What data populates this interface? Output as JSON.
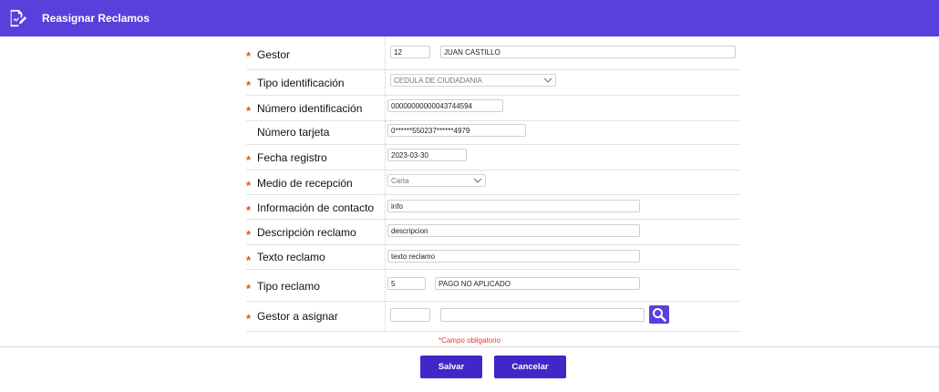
{
  "header": {
    "title": "Reasignar Reclamos",
    "icon": "edit-document-icon"
  },
  "form": {
    "gestor": {
      "label": "Gestor",
      "code": "12",
      "name": "JUAN CASTILLO"
    },
    "tipo_identificacion": {
      "label": "Tipo identificación",
      "selected": "CEDULA DE CIUDADANIA"
    },
    "numero_identificacion": {
      "label": "Número identificación",
      "value": "00000000000043744594"
    },
    "numero_tarjeta": {
      "label": "Número tarjeta",
      "value": "0******550237******4979"
    },
    "fecha_registro": {
      "label": "Fecha registro",
      "value": "2023-03-30"
    },
    "medio_recepcion": {
      "label": "Medio de recepción",
      "selected": "Carta"
    },
    "informacion_contacto": {
      "label": "Información de contacto",
      "value": "info"
    },
    "descripcion_reclamo": {
      "label": "Descripción reclamo",
      "value": "descripcion"
    },
    "texto_reclamo": {
      "label": "Texto reclamo",
      "value": "texto reclamo"
    },
    "tipo_reclamo": {
      "label": "Tipo reclamo",
      "code": "5",
      "name": "PAGO NO APLICADO"
    },
    "gestor_asignar": {
      "label": "Gestor a asignar",
      "code": "",
      "name": ""
    },
    "required_mark": "*",
    "required_note": "*Campo obligatorio"
  },
  "buttons": {
    "save": "Salvar",
    "cancel": "Cancelar"
  },
  "colors": {
    "header": "#5a3fdc",
    "button": "#4326c8",
    "required": "#e2541b"
  }
}
